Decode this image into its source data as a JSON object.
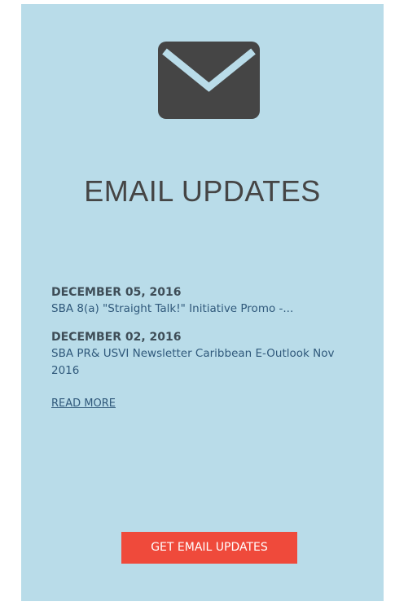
{
  "widget": {
    "icon": "envelope-icon",
    "title": "EMAIL UPDATES",
    "news": [
      {
        "date": "DECEMBER 05, 2016",
        "link": "SBA 8(a) \"Straight Talk!\" Initiative Promo -..."
      },
      {
        "date": "DECEMBER 02, 2016",
        "link": "SBA PR& USVI Newsletter Caribbean E-Outlook Nov 2016"
      }
    ],
    "read_more": "READ MORE",
    "cta_label": "GET EMAIL UPDATES"
  },
  "colors": {
    "panel_background": "#b9dce9",
    "icon": "#454545",
    "cta_background": "#ef4a3b",
    "link": "#30597b"
  }
}
